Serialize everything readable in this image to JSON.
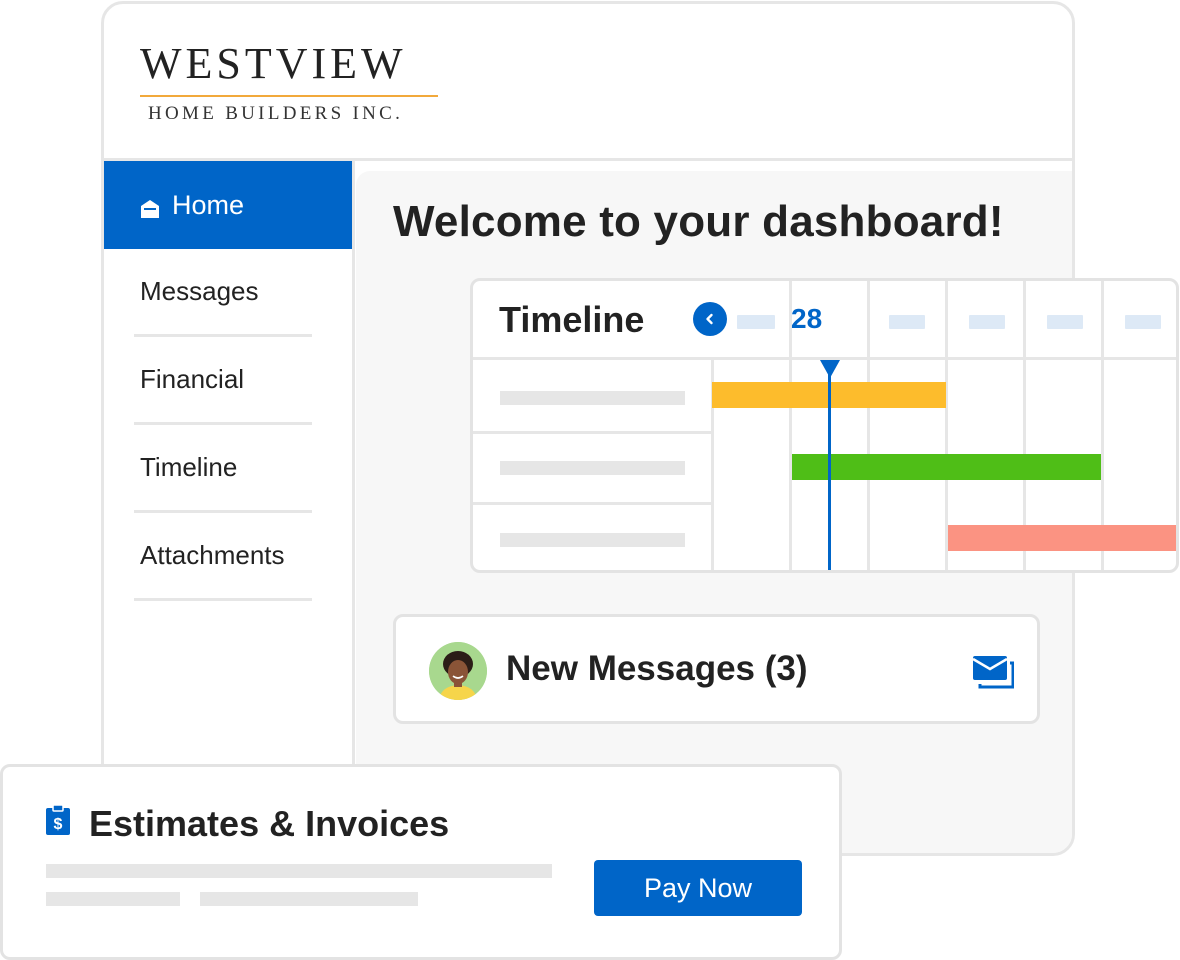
{
  "brand": {
    "name": "WESTVIEW",
    "tagline": "HOME BUILDERS INC."
  },
  "sidebar": {
    "items": [
      {
        "label": "Home",
        "active": true,
        "icon": "home-icon"
      },
      {
        "label": "Messages"
      },
      {
        "label": "Financial"
      },
      {
        "label": "Timeline"
      },
      {
        "label": "Attachments"
      }
    ]
  },
  "main": {
    "heading": "Welcome to your dashboard!"
  },
  "timeline": {
    "title": "Timeline",
    "current_date": "28",
    "prev_icon": "chevron-left-icon",
    "bar_colors": [
      "#fdbc2c",
      "#4fbe17",
      "#fb9382"
    ]
  },
  "messages": {
    "title": "New Messages (3)",
    "icon": "envelope-icon"
  },
  "estimates": {
    "title": "Estimates & Invoices",
    "icon": "invoice-dollar-icon",
    "pay_button": "Pay Now"
  },
  "colors": {
    "accent": "#0065c8",
    "logo_rule": "#f2a93b"
  }
}
